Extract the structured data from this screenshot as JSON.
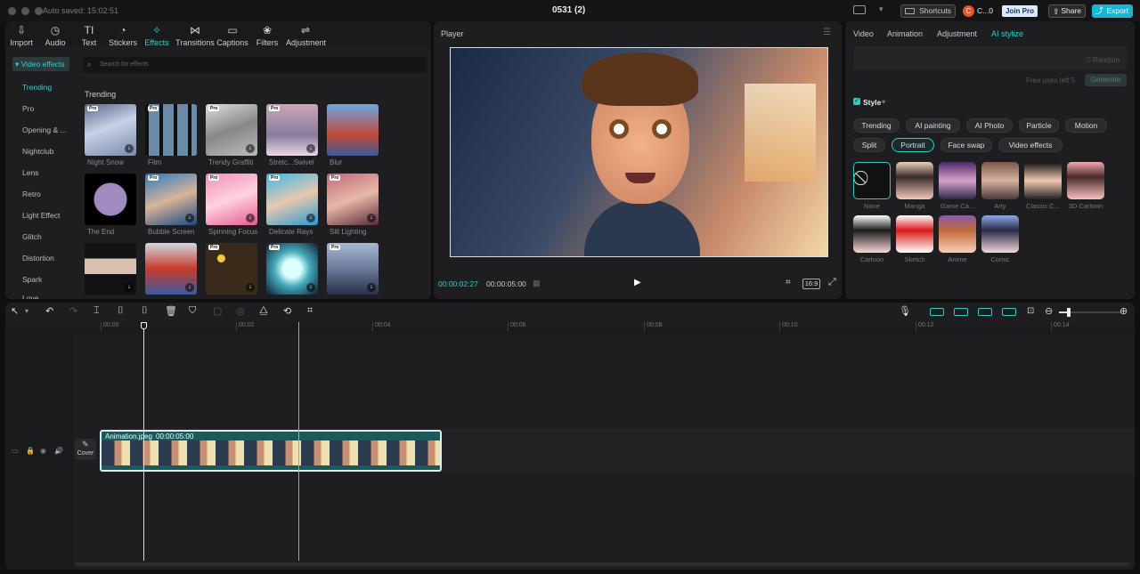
{
  "window": {
    "autosave": "Auto saved: 15:02:51",
    "title": "0531 (2)",
    "shortcuts": "Shortcuts",
    "user": "C...0",
    "join_pro": "Join Pro",
    "share": "Share",
    "export": "Export",
    "avatar_letter": "C"
  },
  "toolbar": [
    {
      "label": "Import",
      "icon": "import-icon"
    },
    {
      "label": "Audio",
      "icon": "audio-icon"
    },
    {
      "label": "Text",
      "icon": "text-icon"
    },
    {
      "label": "Stickers",
      "icon": "stickers-icon"
    },
    {
      "label": "Effects",
      "icon": "effects-icon",
      "active": true
    },
    {
      "label": "Transitions",
      "icon": "transitions-icon"
    },
    {
      "label": "Captions",
      "icon": "captions-icon"
    },
    {
      "label": "Filters",
      "icon": "filters-icon"
    },
    {
      "label": "Adjustment",
      "icon": "adjustment-icon"
    }
  ],
  "effects": {
    "category": "▾ Video effects",
    "search_placeholder": "Search for effects",
    "section": "Trending",
    "sidebar": [
      "Trending",
      "Pro",
      "Opening & ...",
      "Nightclub",
      "Lens",
      "Retro",
      "Light Effect",
      "Glitch",
      "Distortion",
      "Spark",
      "Love"
    ],
    "items": [
      {
        "label": "Night Snow"
      },
      {
        "label": "Film"
      },
      {
        "label": "Trendy Graffiti"
      },
      {
        "label": "Stretc...Swivel"
      },
      {
        "label": "Blur"
      },
      {
        "label": "The End"
      },
      {
        "label": "Bubble Screen"
      },
      {
        "label": "Spinning Focus"
      },
      {
        "label": "Delicate Rays"
      },
      {
        "label": "Slit Lighting"
      },
      {
        "label": ""
      },
      {
        "label": ""
      },
      {
        "label": ""
      },
      {
        "label": ""
      },
      {
        "label": ""
      }
    ],
    "pro_badge": "Pro"
  },
  "player": {
    "title": "Player",
    "current_time": "00:00:02:27",
    "total_time": "00:00:05:00",
    "ratio": "16:9"
  },
  "right": {
    "tabs": [
      "Video",
      "Animation",
      "Adjustment",
      "AI stylize"
    ],
    "random": "Random",
    "free_uses": "Free uses left 5",
    "generate": "Generate",
    "style_label": "Style",
    "style_tabs": [
      "Trending",
      "AI painting",
      "AI Photo",
      "Particle",
      "Motion",
      "Split",
      "Portrait",
      "Face swap",
      "Video effects"
    ],
    "styles": [
      "None",
      "Manga",
      "Game Ca...",
      "Arty",
      "Classic C...",
      "3D Cartoon",
      "Cartoon",
      "Sketch",
      "Anime",
      "Comic"
    ]
  },
  "timeline": {
    "ticks": [
      "00:00",
      "00:02",
      "00:04",
      "00:06",
      "00:08",
      "00:10",
      "00:12",
      "00:14"
    ],
    "clip_name": "Animation.jpeg",
    "clip_duration": "00:00:05:00",
    "cover": "Cover"
  },
  "colors": {
    "accent": "#34d1d1",
    "playhead": "#d4a23a",
    "export": "#17b6d4"
  }
}
